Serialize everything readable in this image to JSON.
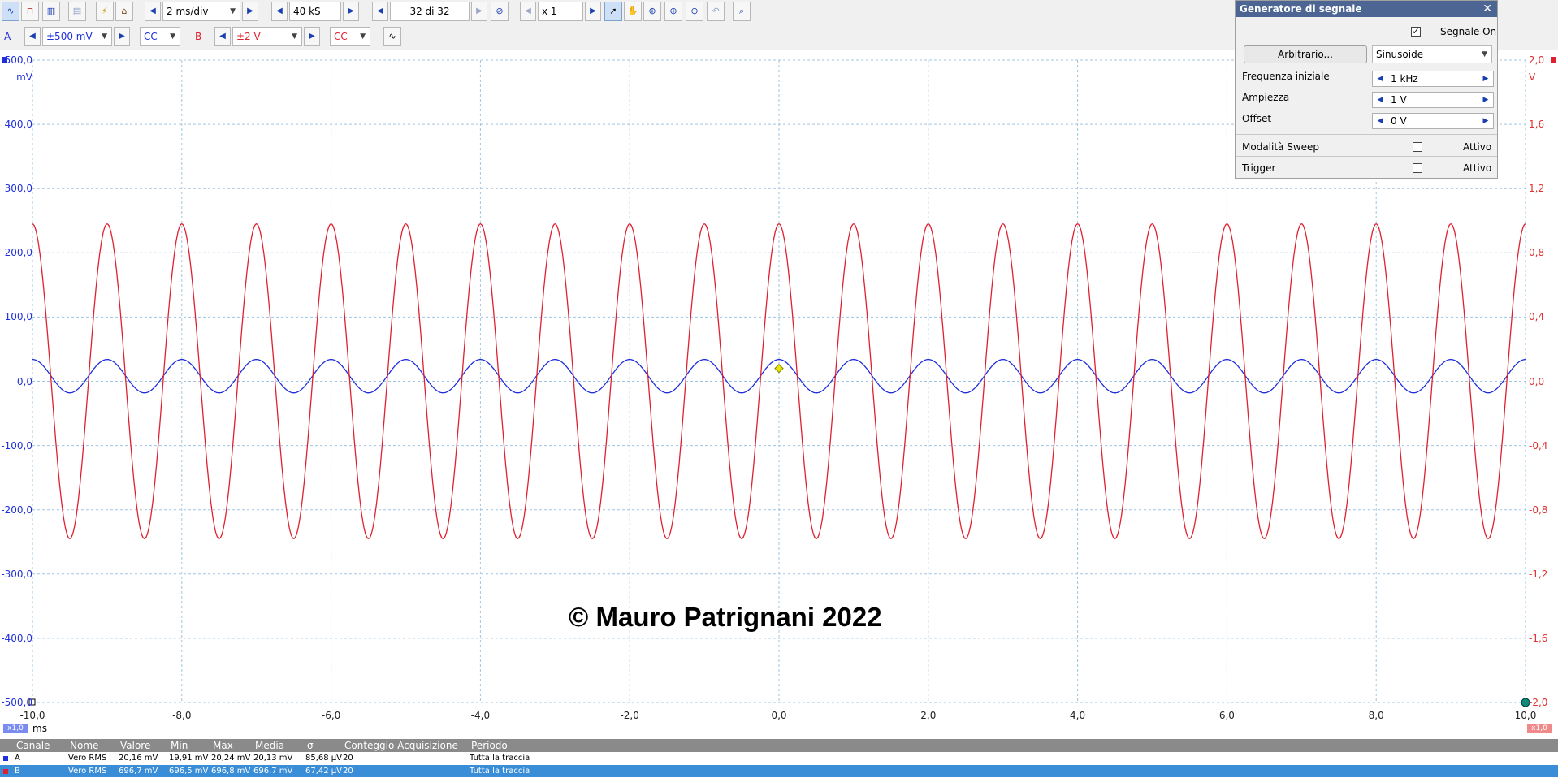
{
  "toolbar1": {
    "timebase": "2 ms/div",
    "samples": "40 kS",
    "buffer": "32 di 32",
    "zoom": "x 1"
  },
  "toolbar2": {
    "chA": {
      "name": "A",
      "range": "±500 mV",
      "coupling": "CC"
    },
    "chB": {
      "name": "B",
      "range": "±2 V",
      "coupling": "CC"
    }
  },
  "plot": {
    "y_left_unit": "mV",
    "y_right_unit": "V",
    "y_left_ticks": [
      "500,0",
      "400,0",
      "300,0",
      "200,0",
      "100,0",
      "0,0",
      "-100,0",
      "-200,0",
      "-300,0",
      "-400,0",
      "-500,0"
    ],
    "y_right_ticks": [
      "2,0",
      "1,6",
      "1,2",
      "0,8",
      "0,4",
      "0,0",
      "-0,4",
      "-0,8",
      "-1,2",
      "-1,6",
      "-2,0"
    ],
    "x_ticks": [
      "-10,0",
      "-8,0",
      "-6,0",
      "-4,0",
      "-2,0",
      "0,0",
      "2,0",
      "4,0",
      "6,0",
      "8,0",
      "10,0"
    ],
    "x_unit": "ms",
    "zoom_left": "x1,0",
    "zoom_right": "x1,0",
    "watermark": "© Mauro Patrignani 2022",
    "colors": {
      "chA": "#1e2fdc",
      "chB": "#e02030",
      "grid": "#9fc4e2"
    }
  },
  "chart_data": {
    "type": "line",
    "x_range_ms": [
      -10,
      10
    ],
    "series": [
      {
        "name": "A",
        "unit": "mV",
        "frequency_hz": 1000,
        "offset": 8,
        "amplitude": 26,
        "ylim": [
          -500,
          500
        ]
      },
      {
        "name": "B",
        "unit": "V",
        "frequency_hz": 1000,
        "offset": 0,
        "amplitude": 0.98,
        "ylim": [
          -2,
          2
        ]
      }
    ]
  },
  "generator": {
    "title": "Generatore di segnale",
    "signal_on_label": "Segnale On",
    "signal_on": true,
    "arbitrary_label": "Arbitrario...",
    "waveform": "Sinusoide",
    "freq_label": "Frequenza iniziale",
    "freq_value": "1 kHz",
    "amp_label": "Ampiezza",
    "amp_value": "1 V",
    "offset_label": "Offset",
    "offset_value": "0 V",
    "sweep_label": "Modalità Sweep",
    "sweep_state": "Attivo",
    "trigger_label": "Trigger",
    "trigger_state": "Attivo"
  },
  "measurements": {
    "headers": [
      "Canale",
      "Nome",
      "Valore",
      "Min",
      "Max",
      "Media",
      "σ",
      "Conteggio Acquisizione",
      "Periodo"
    ],
    "rows": [
      [
        "A",
        "Vero RMS",
        "20,16 mV",
        "19,91 mV",
        "20,24 mV",
        "20,13 mV",
        "85,68 µV",
        "20",
        "Tutta la traccia"
      ],
      [
        "B",
        "Vero RMS",
        "696,7 mV",
        "696,5 mV",
        "696,8 mV",
        "696,7 mV",
        "67,42 µV",
        "20",
        "Tutta la traccia"
      ]
    ]
  }
}
